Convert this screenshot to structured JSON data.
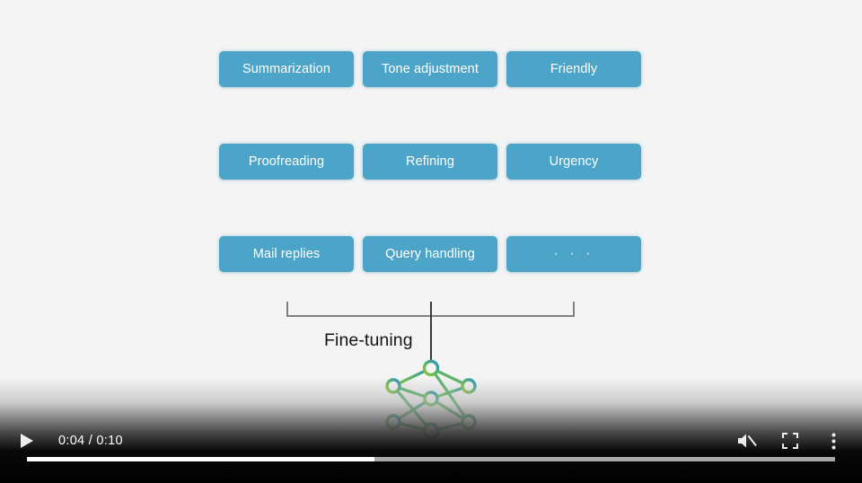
{
  "slide": {
    "chip_rows": [
      {
        "chips": [
          "Summarization",
          "Tone adjustment",
          "Friendly"
        ]
      },
      {
        "chips": [
          "Proofreading",
          "Refining",
          "Urgency"
        ]
      },
      {
        "chips": [
          "Mail replies",
          "Query handling",
          "· · ·"
        ]
      }
    ],
    "bracket_label": "Fine-tuning",
    "logo_name": "neural-network-logo",
    "chip_color": "#4ca5c9",
    "background_color": "#f4f4f4",
    "bracket_color": "#808080",
    "label_color": "#141414"
  },
  "player": {
    "play_label": "Play",
    "current_time": "0:04",
    "separator": "/",
    "duration": "0:10",
    "time_display": "0:04 / 0:10",
    "mute_label": "Unmute",
    "fullscreen_label": "Full screen",
    "more_label": "More options",
    "progress_percent": 43,
    "buffered_percent": 100,
    "played_color": "#ffffff",
    "track_color": "#a8a8a8"
  }
}
